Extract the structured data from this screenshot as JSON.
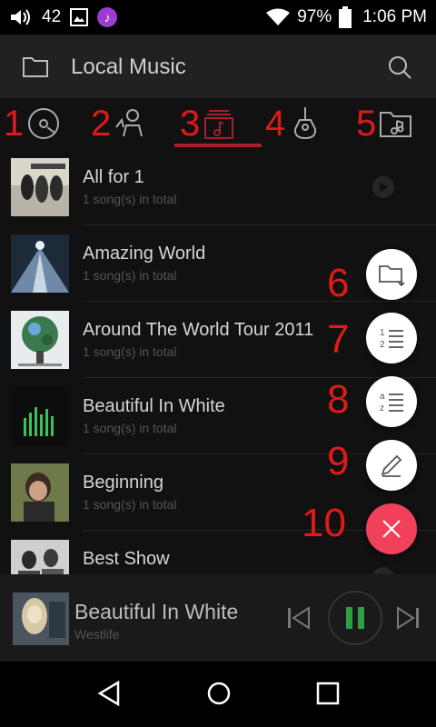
{
  "status": {
    "volume_level": "42",
    "battery": "97%",
    "time": "1:06 PM",
    "icons": [
      "volume-icon",
      "image-icon",
      "music-app-icon",
      "wifi-icon",
      "battery-icon"
    ]
  },
  "header": {
    "title": "Local Music",
    "icons": [
      "folder-icon",
      "search-icon"
    ]
  },
  "tabs": [
    {
      "number": "1",
      "icon": "disc-icon",
      "name": "songs"
    },
    {
      "number": "2",
      "icon": "artist-icon",
      "name": "artists"
    },
    {
      "number": "3",
      "icon": "album-icon",
      "name": "albums",
      "selected": true
    },
    {
      "number": "4",
      "icon": "guitar-icon",
      "name": "genres"
    },
    {
      "number": "5",
      "icon": "music-folder-icon",
      "name": "folders"
    }
  ],
  "albums": [
    {
      "title": "All for 1",
      "subtitle": "1 song(s) in total"
    },
    {
      "title": "Amazing World",
      "subtitle": "1 song(s) in total"
    },
    {
      "title": "Around The World Tour 2011",
      "subtitle": "1 song(s) in total"
    },
    {
      "title": "Beautiful In White",
      "subtitle": "1 song(s) in total"
    },
    {
      "title": "Beginning",
      "subtitle": "1 song(s) in total"
    },
    {
      "title": "Best Show",
      "subtitle": ""
    }
  ],
  "fab_menu": [
    {
      "number": "6",
      "icon": "folder-scan-icon"
    },
    {
      "number": "7",
      "icon": "numbered-list-icon"
    },
    {
      "number": "8",
      "icon": "az-sort-icon"
    },
    {
      "number": "9",
      "icon": "edit-icon"
    },
    {
      "number": "10",
      "icon": "close-icon"
    }
  ],
  "now_playing": {
    "title": "Beautiful In White",
    "artist": "Westlife"
  },
  "colors": {
    "accent": "#a3212a",
    "annotation": "#e01919",
    "fab_close": "#f0405a",
    "play_green": "#2ea043"
  }
}
